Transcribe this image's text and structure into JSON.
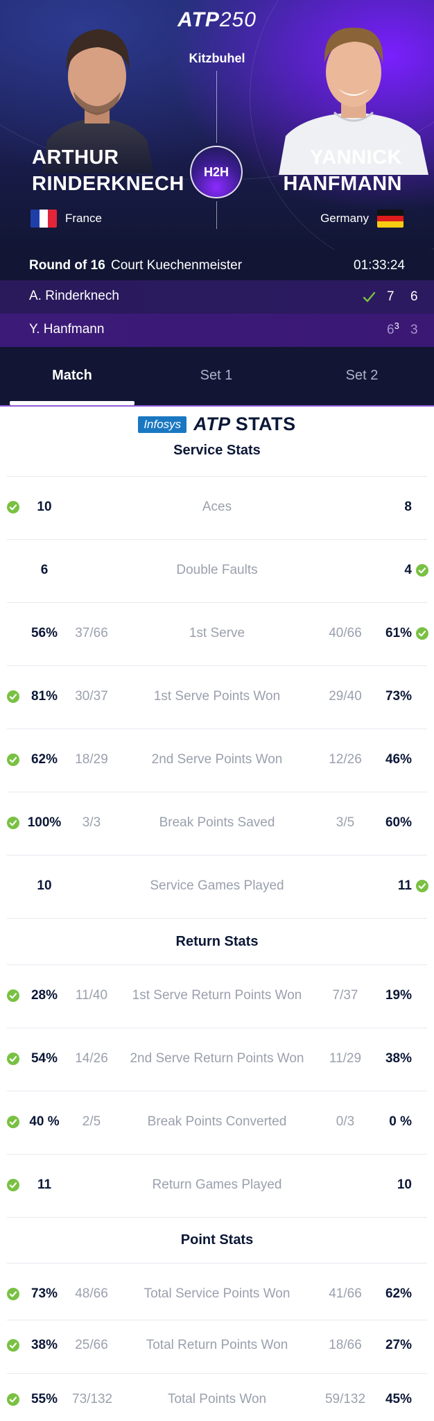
{
  "header": {
    "logo_main": "ATP",
    "logo_num": "250",
    "tournament": "Kitzbuhel",
    "h2h_label": "H2H",
    "player1": {
      "first": "ARTHUR",
      "last": "RINDERKNECH",
      "country": "France"
    },
    "player2": {
      "first": "YANNICK",
      "last": "HANFMANN",
      "country": "Germany"
    }
  },
  "match": {
    "round": "Round of 16",
    "court": "Court Kuechenmeister",
    "duration": "01:33:24",
    "rows": [
      {
        "name": "A. Rinderknech",
        "winner": true,
        "set1": "7",
        "set1_tb": "",
        "set2": "6"
      },
      {
        "name": "Y. Hanfmann",
        "winner": false,
        "set1": "6",
        "set1_tb": "3",
        "set2": "3"
      }
    ]
  },
  "tabs": [
    {
      "label": "Match",
      "active": true
    },
    {
      "label": "Set 1",
      "active": false
    },
    {
      "label": "Set 2",
      "active": false
    }
  ],
  "stats_header": {
    "sponsor": "Infosys",
    "brand": "ATP",
    "suffix": "STATS"
  },
  "sections": {
    "service": "Service Stats",
    "return": "Return Stats",
    "point": "Point Stats"
  },
  "stats": [
    {
      "label": "Aces",
      "p1": "10",
      "p1_raw": "",
      "p2": "8",
      "p2_raw": "",
      "win": 1
    },
    {
      "label": "Double Faults",
      "p1": "6",
      "p1_raw": "",
      "p2": "4",
      "p2_raw": "",
      "win": 2
    },
    {
      "label": "1st Serve",
      "p1": "56%",
      "p1_raw": "37/66",
      "p2": "61%",
      "p2_raw": "40/66",
      "win": 2
    },
    {
      "label": "1st Serve Points Won",
      "p1": "81%",
      "p1_raw": "30/37",
      "p2": "73%",
      "p2_raw": "29/40",
      "win": 1
    },
    {
      "label": "2nd Serve Points Won",
      "p1": "62%",
      "p1_raw": "18/29",
      "p2": "46%",
      "p2_raw": "12/26",
      "win": 1
    },
    {
      "label": "Break Points Saved",
      "p1": "100%",
      "p1_raw": "3/3",
      "p2": "60%",
      "p2_raw": "3/5",
      "win": 1
    },
    {
      "label": "Service Games Played",
      "p1": "10",
      "p1_raw": "",
      "p2": "11",
      "p2_raw": "",
      "win": 2
    },
    {
      "label": "1st Serve Return Points Won",
      "p1": "28%",
      "p1_raw": "11/40",
      "p2": "19%",
      "p2_raw": "7/37",
      "win": 1
    },
    {
      "label": "2nd Serve Return Points Won",
      "p1": "54%",
      "p1_raw": "14/26",
      "p2": "38%",
      "p2_raw": "11/29",
      "win": 1
    },
    {
      "label": "Break Points Converted",
      "p1": "40 %",
      "p1_raw": "2/5",
      "p2": "0 %",
      "p2_raw": "0/3",
      "win": 1
    },
    {
      "label": "Return Games Played",
      "p1": "11",
      "p1_raw": "",
      "p2": "10",
      "p2_raw": "",
      "win": 1
    },
    {
      "label": "Total Service Points Won",
      "p1": "73%",
      "p1_raw": "48/66",
      "p2": "62%",
      "p2_raw": "41/66",
      "win": 1
    },
    {
      "label": "Total Return Points Won",
      "p1": "38%",
      "p1_raw": "25/66",
      "p2": "27%",
      "p2_raw": "18/66",
      "win": 1
    },
    {
      "label": "Total Points Won",
      "p1": "55%",
      "p1_raw": "73/132",
      "p2": "45%",
      "p2_raw": "59/132",
      "win": 1
    }
  ],
  "colors": {
    "accent_green": "#79c142",
    "header_dark": "#121634",
    "purple": "#7a20ff"
  },
  "icons": {
    "winner_check": "check-icon",
    "stat_leader": "green-check-circle-icon"
  }
}
